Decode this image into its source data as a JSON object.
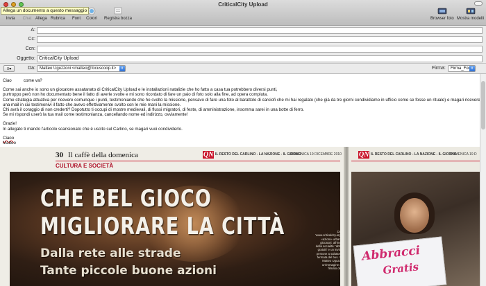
{
  "window": {
    "title": "CriticalCity Upload",
    "tooltip": "Allega un documento a questo messaggio"
  },
  "toolbar": {
    "items": [
      {
        "label": "Invia",
        "icon": "send-icon",
        "enabled": true
      },
      {
        "label": "Chat",
        "icon": "chat-icon",
        "enabled": false
      },
      {
        "label": "Allega",
        "icon": "paperclip-icon",
        "enabled": true
      },
      {
        "label": "Rubrica",
        "icon": "address-book-icon",
        "enabled": true
      },
      {
        "label": "Font",
        "icon": "font-icon",
        "enabled": true
      },
      {
        "label": "Colori",
        "icon": "color-wheel-icon",
        "enabled": true
      },
      {
        "label": "Registra bozza",
        "icon": "save-draft-icon",
        "enabled": true
      }
    ],
    "right_items": [
      {
        "label": "Browser foto",
        "icon": "photo-browser-icon"
      },
      {
        "label": "Mostra modelli",
        "icon": "stationery-icon"
      }
    ]
  },
  "fields": {
    "to_label": "A:",
    "to_value": "",
    "cc_label": "Cc:",
    "cc_value": "",
    "bcc_label": "Ccn:",
    "bcc_value": "",
    "subject_label": "Oggetto:",
    "subject_value": "CriticalCity Upload",
    "from_label": "Da:",
    "from_value": "Matteo Uguzzoni <matteo@focuscoop.it>",
    "signature_label": "Firma:",
    "signature_value": "Firma_Focus"
  },
  "message": {
    "greeting": "Ciao          come va?",
    "lines": [
      "Come sai anche io sono un giocatore assatanato di CriticalCity Upload e le installazioni natalizie che ho fatto a casa tua potrebbero diversi punti,",
      "purtroppo però non ho documentato bene il fatto di averle svolte e mi sono ricordato di fare un paio di foto solo alla fine, ad opera compiuta.",
      "Come strategia attuativa per ricevere comunque i punti, testimoniando che ho svolto la missione, pensavo di fare una foto al barattolo di carciofi che mi hai regalato (che già da tre giorni condividiamo in ufficio come se fosse un rituale) e magari ricevere da te",
      "una mail in cui testimonivi il fatto che avevo effettivamente svolto con le mie mani la missione.",
      "Chi avrà il coraggio di non crederti? Dopotutto ti occupi di mostre medievali, di flussi migratori, di feste, di amministrazione, insomma sarei in una botte di ferro.",
      "Se mi rispondi userò la tua mail come testimonianza, cancellando nome ed indirizzo, ovviamente!"
    ],
    "thanks": "Grazie!",
    "attachment_line": "In allegato ti mando l'articolo scansionato che è uscito sul Carlino, se magari vuoi condividerlo.",
    "closing": "Ciaoo",
    "signature": "Matteo"
  },
  "newspaper": {
    "page_number": "30",
    "section_title": "Il caffè della domenica",
    "masthead_logo": "QN",
    "masthead_text": "IL RESTO DEL CARLINO - LA NAZIONE - IL GIORNO",
    "date": "DOMENICA 19 DICEMBRE 2010",
    "date_right": "DOMENICA 19 D",
    "category": "CULTURA E SOCIETÀ",
    "headline_1": "CHE BEL GIOCO",
    "headline_2": "MIGLIORARE LA CITTÀ",
    "subheadline_1": "Dalla rete alle strade",
    "subheadline_2": "Tante piccole buone azioni",
    "photo_caption": "Dal sito 'www.criticalcity.org' due «azioni» urbane dei giocatori: all'insegna della socialità: 'abbracci gratuiti' e un invito alle persone a salutarsi alla fermata del bus. Sotto: Matteo Uguzzoni e un'immagine da un filmato del sito",
    "sign_text_1": "Abbracci",
    "sign_text_2": "Gratis"
  },
  "colors": {
    "accent_red": "#c9152b",
    "select_blue": "#2b6fd6",
    "tooltip_bg": "#ffffc4"
  }
}
